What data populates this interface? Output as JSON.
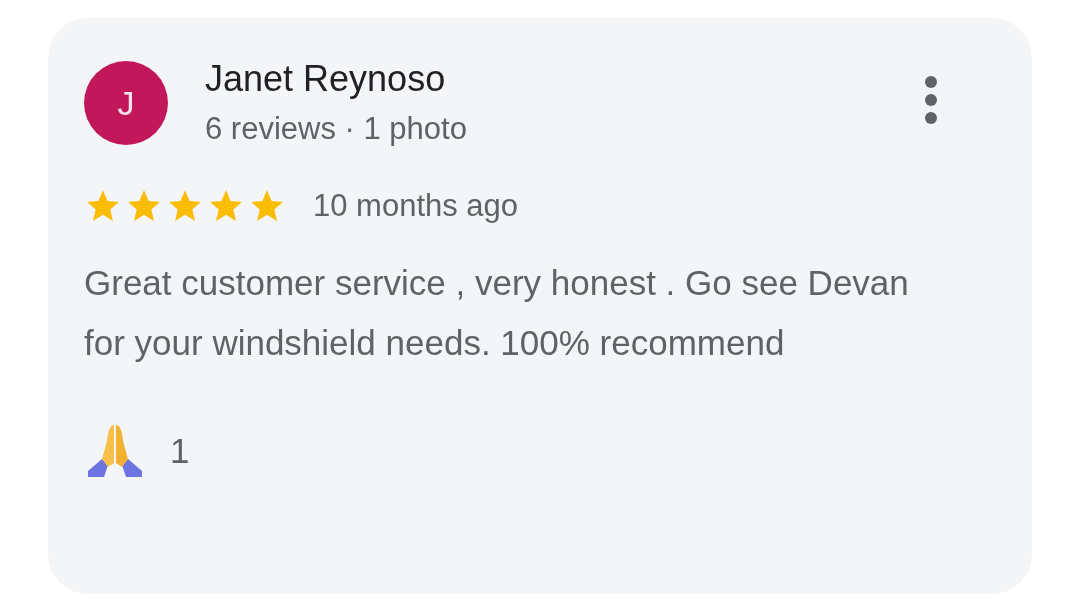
{
  "review": {
    "avatar_letter": "J",
    "author": "Janet Reynoso",
    "author_stats": "6 reviews · 1 photo",
    "stars": 5,
    "time": "10 months ago",
    "text": "Great customer service , very honest . Go see Devan for your windshield needs. 100% recommend",
    "reaction_count": "1"
  }
}
